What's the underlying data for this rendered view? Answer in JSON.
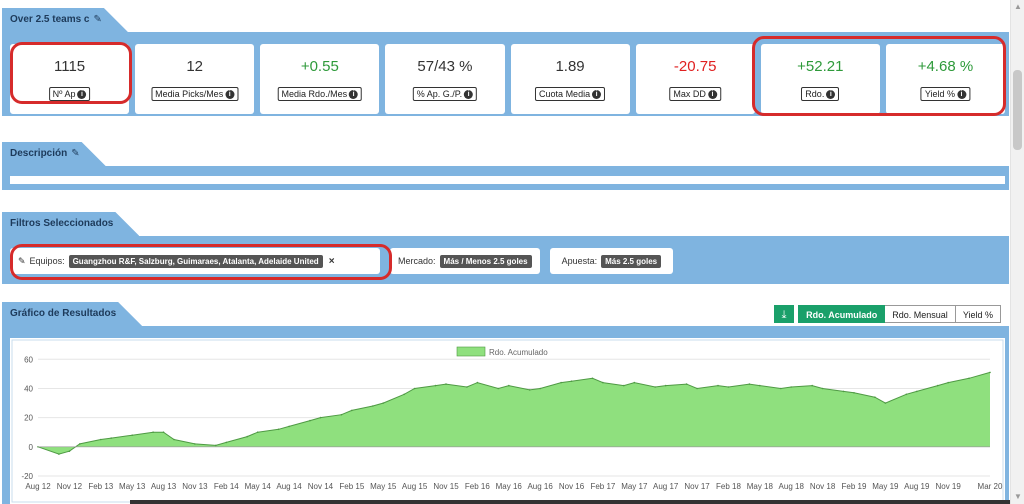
{
  "stats_panel": {
    "title": "Over 2.5 teams c",
    "items": [
      {
        "value": "1115",
        "label": "Nº Ap",
        "tone": "neutral"
      },
      {
        "value": "12",
        "label": "Media Picks/Mes",
        "tone": "neutral"
      },
      {
        "value": "+0.55",
        "label": "Media Rdo./Mes",
        "tone": "pos"
      },
      {
        "value": "57/43 %",
        "label": "% Ap. G./P.",
        "tone": "neutral"
      },
      {
        "value": "1.89",
        "label": "Cuota Media",
        "tone": "neutral"
      },
      {
        "value": "-20.75",
        "label": "Max DD",
        "tone": "neg"
      },
      {
        "value": "+52.21",
        "label": "Rdo.",
        "tone": "pos"
      },
      {
        "value": "+4.68 %",
        "label": "Yield %",
        "tone": "pos"
      }
    ]
  },
  "description_panel": {
    "title": "Descripción"
  },
  "filters_panel": {
    "title": "Filtros Seleccionados",
    "equipos_label": "Equipos:",
    "equipos_value": "Guangzhou R&F, Salzburg, Guimaraes, Atalanta, Adelaide United",
    "mercado_label": "Mercado:",
    "mercado_value": "Más / Menos 2.5 goles",
    "apuesta_label": "Apuesta:",
    "apuesta_value": "Más 2.5 goles"
  },
  "chart_panel": {
    "title": "Gráfico de Resultados",
    "buttons": [
      "Rdo. Acumulado",
      "Rdo. Mensual",
      "Yield %"
    ],
    "active_button": "Rdo. Acumulado"
  },
  "colors": {
    "panel_blue": "#7fb4e0",
    "positive": "#2e9a3a",
    "negative": "#e02020",
    "active_green": "#1aa06a",
    "area_fill": "#8fe07e",
    "annotation_red": "#d62b2b"
  },
  "chart_data": {
    "type": "area",
    "legend": [
      "Rdo. Acumulado"
    ],
    "legend_position": "top-center",
    "x_ticks": [
      "Aug 12",
      "Nov 12",
      "Feb 13",
      "May 13",
      "Aug 13",
      "Nov 13",
      "Feb 14",
      "May 14",
      "Aug 14",
      "Nov 14",
      "Feb 15",
      "May 15",
      "Aug 15",
      "Nov 15",
      "Feb 16",
      "May 16",
      "Aug 16",
      "Nov 16",
      "Feb 17",
      "May 17",
      "Aug 17",
      "Nov 17",
      "Feb 18",
      "May 18",
      "Aug 18",
      "Nov 18",
      "Feb 19",
      "May 19",
      "Aug 19",
      "Nov 19",
      "Mar 20"
    ],
    "y_ticks": [
      -20,
      0,
      20,
      40,
      60
    ],
    "ylim": [
      -20,
      65
    ],
    "grid": true,
    "series": [
      {
        "name": "Rdo. Acumulado",
        "x": [
          "Aug 12",
          "Oct 12",
          "Nov 12",
          "Dec 12",
          "Feb 13",
          "Mar 13",
          "May 13",
          "Jul 13",
          "Aug 13",
          "Sep 13",
          "Nov 13",
          "Jan 14",
          "Feb 14",
          "Apr 14",
          "May 14",
          "Jul 14",
          "Aug 14",
          "Oct 14",
          "Nov 14",
          "Jan 15",
          "Feb 15",
          "Apr 15",
          "May 15",
          "Jul 15",
          "Aug 15",
          "Oct 15",
          "Nov 15",
          "Jan 16",
          "Feb 16",
          "Apr 16",
          "May 16",
          "Jul 16",
          "Aug 16",
          "Oct 16",
          "Nov 16",
          "Jan 17",
          "Feb 17",
          "Apr 17",
          "May 17",
          "Jul 17",
          "Aug 17",
          "Oct 17",
          "Nov 17",
          "Jan 18",
          "Feb 18",
          "Apr 18",
          "May 18",
          "Jul 18",
          "Aug 18",
          "Oct 18",
          "Nov 18",
          "Jan 19",
          "Feb 19",
          "Apr 19",
          "May 19",
          "Jul 19",
          "Aug 19",
          "Oct 19",
          "Nov 19",
          "Jan 20",
          "Mar 20"
        ],
        "y": [
          0,
          -5,
          -3,
          2,
          5,
          6,
          8,
          10,
          10,
          5,
          2,
          1,
          3,
          7,
          10,
          12,
          14,
          18,
          20,
          22,
          25,
          28,
          30,
          36,
          40,
          42,
          43,
          41,
          44,
          40,
          42,
          39,
          40,
          44,
          45,
          47,
          44,
          42,
          44,
          41,
          42,
          43,
          40,
          42,
          41,
          43,
          42,
          40,
          41,
          42,
          40,
          38,
          37,
          34,
          30,
          36,
          38,
          42,
          44,
          47,
          51
        ]
      }
    ]
  }
}
